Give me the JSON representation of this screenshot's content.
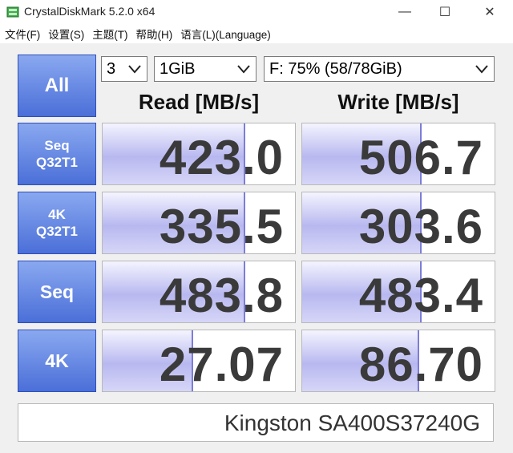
{
  "window": {
    "title": "CrystalDiskMark 5.2.0 x64",
    "minimize_label": "—",
    "maximize_label": "☐",
    "close_label": "✕"
  },
  "menu": [
    {
      "label": "文件(F)"
    },
    {
      "label": "设置(S)"
    },
    {
      "label": "主题(T)"
    },
    {
      "label": "帮助(H)"
    },
    {
      "label": "语言(L)(Language)"
    }
  ],
  "controls": {
    "all_label": "All",
    "count_value": "3",
    "size_value": "1GiB",
    "drive_value": "F: 75% (58/78GiB)"
  },
  "headers": {
    "read": "Read [MB/s]",
    "write": "Write [MB/s]"
  },
  "rows": [
    {
      "line1": "Seq",
      "line2": "Q32T1",
      "read": "423.0",
      "write": "506.7",
      "read_fill": 0.74,
      "write_fill": 0.62
    },
    {
      "line1": "4K",
      "line2": "Q32T1",
      "read": "335.5",
      "write": "303.6",
      "read_fill": 0.74,
      "write_fill": 0.62
    },
    {
      "line1": "Seq",
      "line2": "",
      "read": "483.8",
      "write": "483.4",
      "read_fill": 0.74,
      "write_fill": 0.62
    },
    {
      "line1": "4K",
      "line2": "",
      "read": "27.07",
      "write": "86.70",
      "read_fill": 0.47,
      "write_fill": 0.61
    }
  ],
  "drive_model": "Kingston SA400S37240G",
  "colors": {
    "button_top": "#8aa8f0",
    "button_bottom": "#4a6fd8",
    "bar_fill": "#b8b8f0",
    "value_text": "#3a3a3a"
  }
}
